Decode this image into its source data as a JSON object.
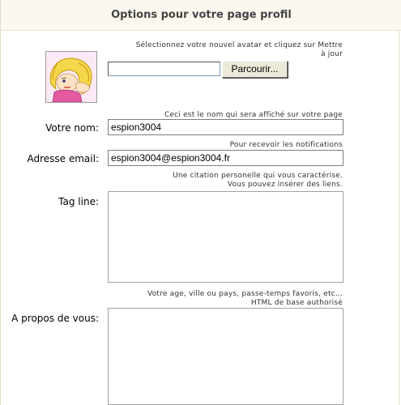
{
  "header": {
    "title": "Options pour votre page profil"
  },
  "avatar": {
    "hint_line1": "Sélectionnez votre nouvel avatar et cliquez sur Mettre",
    "hint_line2": "à jour",
    "file_value": "",
    "browse_label": "Parcourir..."
  },
  "name": {
    "hint": "Ceci est le nom qui sera affiché sur votre page",
    "label": "Votre nom:",
    "value": "espion3004"
  },
  "email": {
    "hint": "Pour recevoir les notifications",
    "label": "Adresse email:",
    "value": "espion3004@espion3004.fr"
  },
  "tagline": {
    "hint_line1": "Une citation personelle qui vous caractérise.",
    "hint_line2": "Vous pouvez insérer des liens.",
    "label": "Tag line:",
    "value": ""
  },
  "about": {
    "hint_line1": "Votre age, ville ou pays, passe-temps favoris, etc...",
    "hint_line2": "HTML de base authorisé",
    "label": "A propos de vous:",
    "value": ""
  },
  "colors": {
    "header_bg": "#fbf8f0",
    "panel_border": "#e6dcc4",
    "title_text": "#444444"
  },
  "icons": {
    "avatar": "cartoon-avatar-image"
  }
}
